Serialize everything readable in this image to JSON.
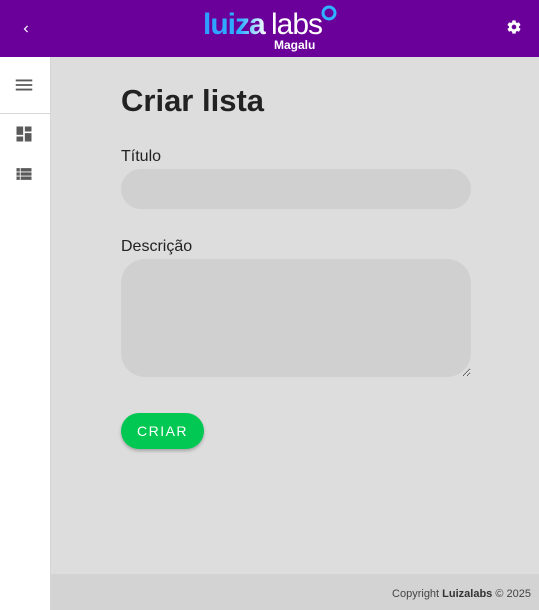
{
  "header": {
    "brand": "luizalabs",
    "brand_sub": "Magalu",
    "back_icon": "chevron-left-icon",
    "settings_icon": "gear-icon"
  },
  "sidebar": {
    "items": [
      {
        "icon": "menu-icon"
      },
      {
        "icon": "dashboard-icon"
      },
      {
        "icon": "list-icon"
      }
    ]
  },
  "form": {
    "title": "Criar lista",
    "title_label": "Título",
    "title_value": "",
    "description_label": "Descrição",
    "description_value": "",
    "submit_label": "CRIAR"
  },
  "footer": {
    "copyright_prefix": "Copyright",
    "company": "Luizalabs",
    "year": "© 2025"
  },
  "colors": {
    "topbar": "#6a0099",
    "primary_button": "#00c853",
    "background": "#dddddd"
  }
}
